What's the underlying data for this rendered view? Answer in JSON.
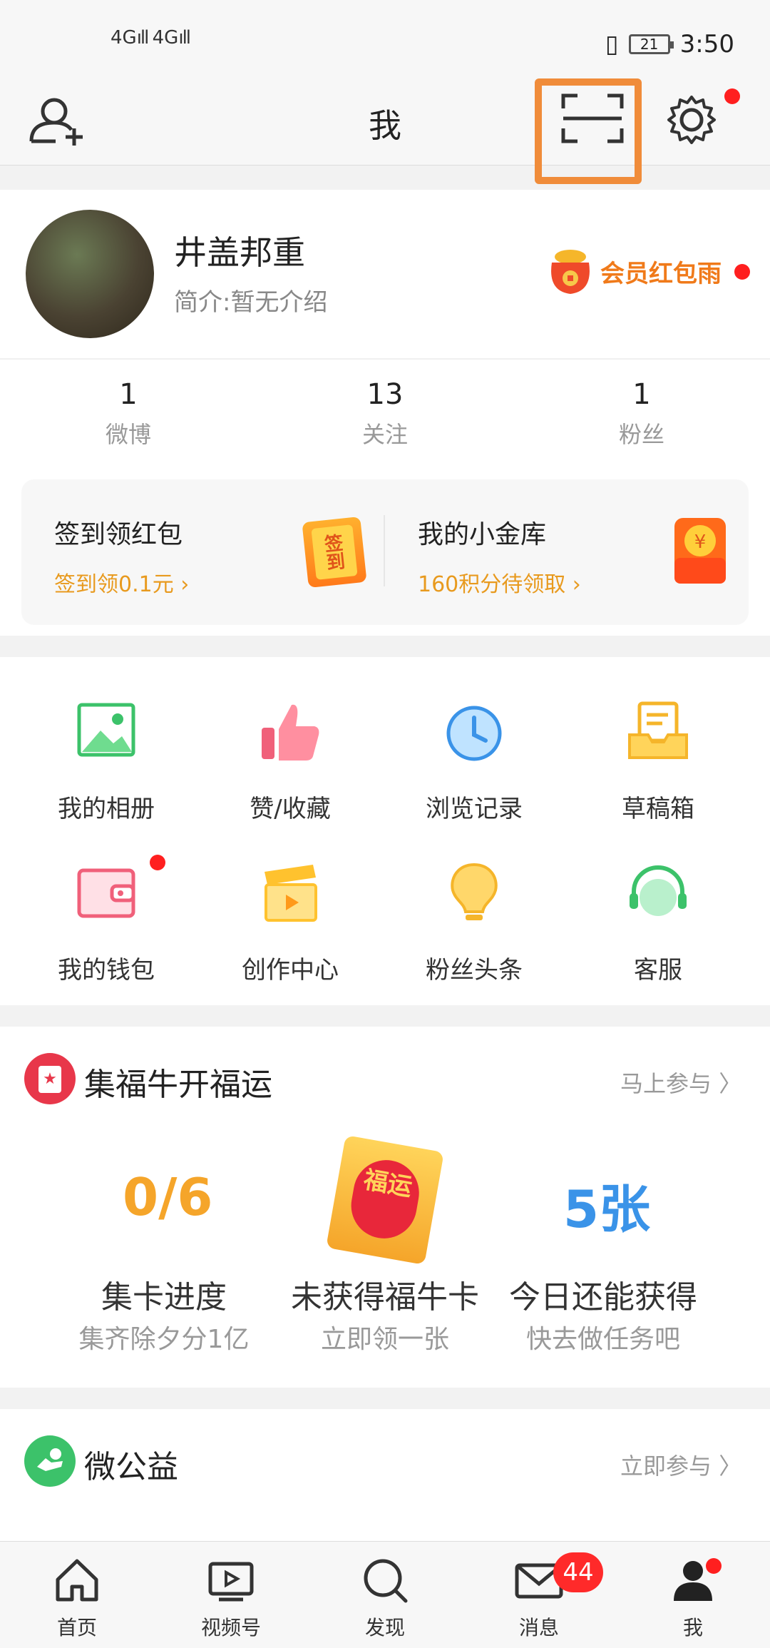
{
  "status_bar": {
    "signal_left": "4G",
    "signal_right": "4G",
    "battery": "21",
    "time": "3:50"
  },
  "header": {
    "title": "我"
  },
  "profile": {
    "username": "井盖邦重",
    "bio": "简介:暂无介绍",
    "vip_promo": "会员红包雨"
  },
  "stats": [
    {
      "value": "1",
      "label": "微博"
    },
    {
      "value": "13",
      "label": "关注"
    },
    {
      "value": "1",
      "label": "粉丝"
    }
  ],
  "promo_box": {
    "checkin_title": "签到领红包",
    "checkin_sub": "签到领0.1元 ›",
    "checkin_icon_text": "签到",
    "vault_title": "我的小金库",
    "vault_sub": "160积分待领取 ›"
  },
  "grid": [
    {
      "label": "我的相册"
    },
    {
      "label": "赞/收藏"
    },
    {
      "label": "浏览记录"
    },
    {
      "label": "草稿箱"
    },
    {
      "label": "我的钱包"
    },
    {
      "label": "创作中心"
    },
    {
      "label": "粉丝头条"
    },
    {
      "label": "客服"
    }
  ],
  "fu_section": {
    "title": "集福牛开福运",
    "more": "马上参与",
    "progress_value": "0/6",
    "progress_label": "集卡进度",
    "progress_sub": "集齐除夕分1亿",
    "card_label": "未获得福牛卡",
    "card_sub": "立即领一张",
    "card_icon_text": "福运",
    "today_value": "5张",
    "today_label": "今日还能获得",
    "today_sub": "快去做任务吧"
  },
  "charity_section": {
    "title": "微公益",
    "more": "立即参与"
  },
  "tabbar": {
    "tabs": [
      {
        "label": "首页"
      },
      {
        "label": "视频号"
      },
      {
        "label": "发现"
      },
      {
        "label": "消息"
      },
      {
        "label": "我"
      }
    ],
    "message_badge": "44"
  },
  "colors": {
    "accent_orange": "#f07a1a",
    "gold": "#e89a1e",
    "blue": "#3a93e8",
    "red_dot": "#ff1f1f"
  }
}
